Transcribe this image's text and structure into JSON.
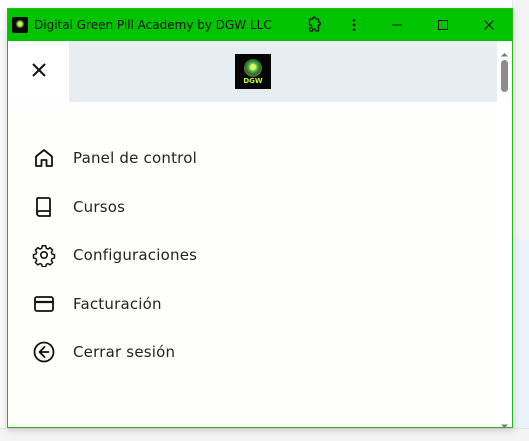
{
  "window": {
    "title": "Digital Green Pill Academy by DGW LLC",
    "accent_color": "#00c400",
    "controls": {
      "extensions_icon": "puzzle-icon",
      "more_icon": "kebab-menu-icon",
      "minimize_icon": "minimize-icon",
      "maximize_icon": "maximize-icon",
      "close_icon": "close-icon"
    }
  },
  "header": {
    "close_icon": "close-icon",
    "logo_text": "DGW"
  },
  "menu": {
    "items": [
      {
        "label": "Panel de control",
        "icon": "home-icon"
      },
      {
        "label": "Cursos",
        "icon": "book-icon"
      },
      {
        "label": "Configuraciones",
        "icon": "gear-icon"
      },
      {
        "label": "Facturación",
        "icon": "credit-card-icon"
      },
      {
        "label": "Cerrar sesión",
        "icon": "arrow-left-circle-icon"
      }
    ]
  }
}
